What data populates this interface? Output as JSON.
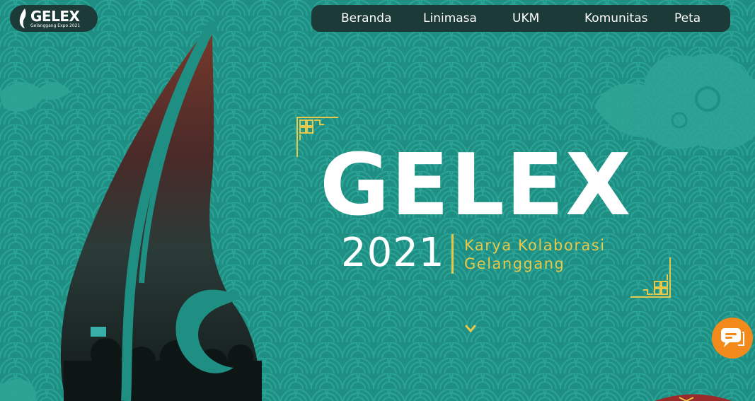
{
  "logo": {
    "title": "GELEX",
    "subtitle": "Gelanggang Expo 2021"
  },
  "nav": {
    "items": [
      {
        "label": "Beranda"
      },
      {
        "label": "Linimasa"
      },
      {
        "label": "UKM"
      },
      {
        "label": "Komunitas"
      },
      {
        "label": "Peta"
      }
    ]
  },
  "hero": {
    "title": "GELEX",
    "year": "2021",
    "tagline_line1": "Karya Kolaborasi",
    "tagline_line2": "Gelanggang"
  },
  "icons": {
    "scroll": "chevron-down-icon",
    "chat": "chat-icon"
  },
  "colors": {
    "background": "#1f8f84",
    "nav_bg": "#1c3a37",
    "accent_gold": "#e6c94a",
    "chat_orange": "#f28a1c"
  }
}
